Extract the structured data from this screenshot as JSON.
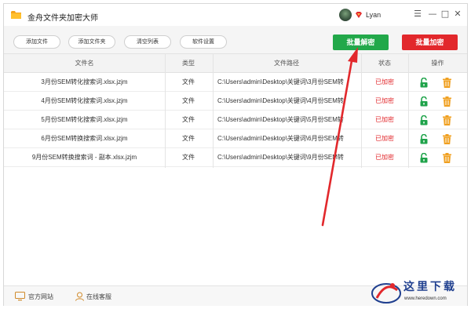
{
  "app": {
    "title": "金舟文件夹加密大师"
  },
  "user": {
    "name": "Lyan"
  },
  "window_controls": {
    "menu": "☰",
    "minimize": "—",
    "maximize": "□",
    "close": "✕"
  },
  "toolbar": {
    "add_file": "添加文件",
    "add_folder": "添加文件夹",
    "clear_list": "清空列表",
    "settings": "软件设置",
    "batch_decrypt": "批量解密",
    "batch_encrypt": "批量加密"
  },
  "table": {
    "headers": {
      "name": "文件名",
      "type": "类型",
      "path": "文件路径",
      "status": "状态",
      "action": "操作"
    },
    "rows": [
      {
        "name": "3月份SEM转化搜索词.xlsx.jzjm",
        "type": "文件",
        "path": "C:\\Users\\admin\\Desktop\\关键词\\3月份SEM转",
        "status": "已加密"
      },
      {
        "name": "4月份SEM转化搜索词.xlsx.jzjm",
        "type": "文件",
        "path": "C:\\Users\\admin\\Desktop\\关键词\\4月份SEM转",
        "status": "已加密"
      },
      {
        "name": "5月份SEM转化搜索词.xlsx.jzjm",
        "type": "文件",
        "path": "C:\\Users\\admin\\Desktop\\关键词\\5月份SEM转",
        "status": "已加密"
      },
      {
        "name": "6月份SEM转换搜索词.xlsx.jzjm",
        "type": "文件",
        "path": "C:\\Users\\admin\\Desktop\\关键词\\6月份SEM转",
        "status": "已加密"
      },
      {
        "name": "9月份SEM转换搜索词 - 副本.xlsx.jzjm",
        "type": "文件",
        "path": "C:\\Users\\admin\\Desktop\\关键词\\9月份SEM转",
        "status": "已加密"
      }
    ]
  },
  "statusbar": {
    "website": "官方网站",
    "support": "在线客服"
  },
  "watermark": {
    "name": "这里下载",
    "url": "www.heredown.com"
  },
  "colors": {
    "decrypt": "#22a84a",
    "encrypt": "#e2282c",
    "status_encrypted": "#e2282c",
    "unlock_icon": "#1fa34a",
    "trash_icon": "#f0a020",
    "arrow": "#e2282c"
  }
}
